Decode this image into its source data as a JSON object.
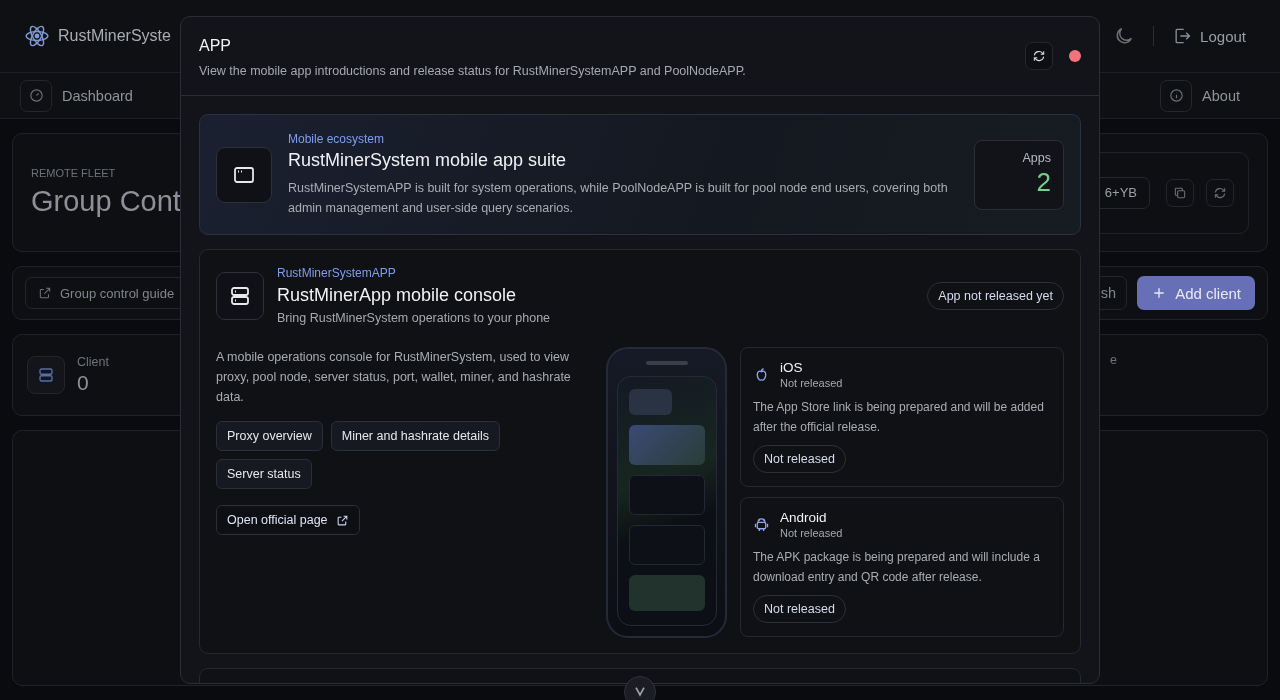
{
  "header": {
    "brand": "RustMinerSyste",
    "logout": "Logout"
  },
  "nav": [
    {
      "kind": "dashboard",
      "label": "Dashboard"
    },
    {
      "kind": "about",
      "label": "About"
    }
  ],
  "fleet": {
    "eyebrow": "REMOTE FLEET",
    "title": "Group Cont",
    "token": "6+YB"
  },
  "toolbar": {
    "guide": "Group control guide",
    "refresh": "sh",
    "add": "Add client"
  },
  "stats": [
    {
      "label": "Client",
      "value": "0"
    },
    {
      "label": "e"
    }
  ],
  "modal": {
    "title": "APP",
    "subtitle": "View the mobile app introductions and release status for RustMinerSystemAPP and PoolNodeAPP.",
    "suite": {
      "eyebrow": "Mobile ecosystem",
      "title": "RustMinerSystem mobile app suite",
      "description": "RustMinerSystemAPP is built for system operations, while PoolNodeAPP is built for pool node end users, covering both admin management and user-side query scenarios.",
      "count_label": "Apps",
      "count": "2"
    },
    "apps": [
      {
        "eyebrow": "RustMinerSystemAPP",
        "title": "RustMinerApp mobile console",
        "subtitle": "Bring RustMinerSystem operations to your phone",
        "badge": "App not released yet",
        "description": "A mobile operations console for RustMinerSystem, used to view proxy, pool node, server status, port, wallet, miner, and hashrate data.",
        "features": [
          "Proxy overview",
          "Miner and hashrate details",
          "Server status"
        ],
        "link": "Open official page",
        "platforms": [
          {
            "kind": "ios",
            "name": "iOS",
            "status": "Not released",
            "description": "The App Store link is being prepared and will be added after the official release.",
            "badge": "Not released"
          },
          {
            "kind": "android",
            "name": "Android",
            "status": "Not released",
            "description": "The APK package is being prepared and will include a download entry and QR code after release.",
            "badge": "Not released"
          }
        ]
      }
    ]
  }
}
